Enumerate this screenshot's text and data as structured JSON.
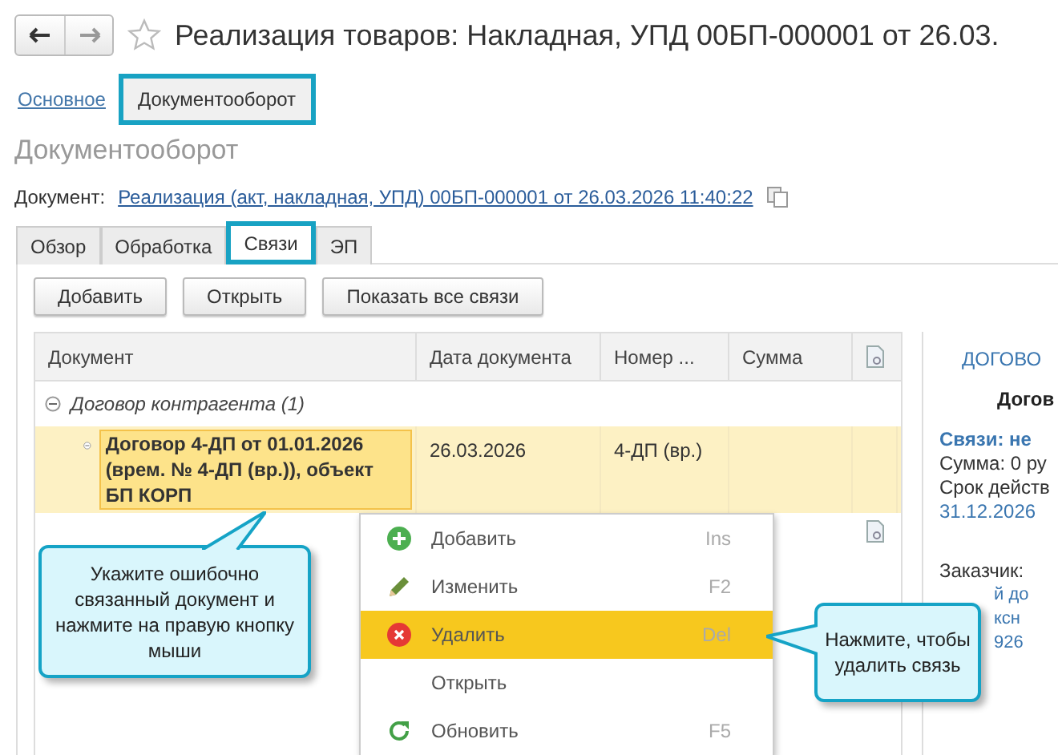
{
  "window": {
    "title": "Реализация товаров: Накладная, УПД 00БП-000001 от 26.03."
  },
  "section_tabs": [
    {
      "label": "Основное",
      "selected": false
    },
    {
      "label": "Документооборот",
      "selected": true
    }
  ],
  "page_heading": "Документооборот",
  "document_field": {
    "label": "Документ:",
    "value": "Реализация (акт, накладная, УПД) 00БП-000001 от 26.03.2026 11:40:22"
  },
  "tabs": [
    {
      "label": "Обзор",
      "selected": false
    },
    {
      "label": "Обработка",
      "selected": false
    },
    {
      "label": "Связи",
      "selected": true
    },
    {
      "label": "ЭП",
      "selected": false
    }
  ],
  "toolbar": [
    "Добавить",
    "Открыть",
    "Показать все связи"
  ],
  "table": {
    "columns": [
      "Документ",
      "Дата документа",
      "Номер ...",
      "Сумма"
    ],
    "rows": [
      {
        "kind": "group",
        "expanded": true,
        "document": "Договор контрагента (1)"
      },
      {
        "kind": "item",
        "expanded": true,
        "selected": true,
        "document": "Договор 4-ДП от 01.01.2026 (врем. № 4-ДП (вр.)), объект БП КОРП",
        "date": "26.03.2026",
        "number": "4-ДП (вр.)"
      },
      {
        "kind": "stub",
        "attachment": true
      }
    ]
  },
  "side_panel": [
    {
      "kind": "caption",
      "text": "ДОГОВО"
    },
    {
      "kind": "title",
      "text": "Догов"
    },
    {
      "kind": "status",
      "text": "Связи: не"
    },
    {
      "kind": "text",
      "text": "Сумма: 0 ру"
    },
    {
      "kind": "text",
      "text": "Срок действ"
    },
    {
      "kind": "link",
      "text": "31.12.2026"
    },
    {
      "kind": "gap"
    },
    {
      "kind": "text",
      "text": "Заказчик:"
    },
    {
      "kind": "link",
      "text": "й до"
    },
    {
      "kind": "link",
      "text": "ксн"
    },
    {
      "kind": "link",
      "text": "926"
    }
  ],
  "context_menu": [
    {
      "kind": "add",
      "label": "Добавить",
      "shortcut": "Ins",
      "selected": false
    },
    {
      "kind": "edit",
      "label": "Изменить",
      "shortcut": "F2",
      "selected": false
    },
    {
      "kind": "delete",
      "label": "Удалить",
      "shortcut": "Del",
      "selected": true
    },
    {
      "kind": "plain",
      "label": "Открыть",
      "selected": false
    },
    {
      "kind": "refresh",
      "label": "Обновить",
      "shortcut": "F5",
      "selected": false
    }
  ],
  "callouts": [
    {
      "kind": "up",
      "text": "Укажите ошибочно связанный документ и нажмите на правую кнопку мыши"
    },
    {
      "kind": "left",
      "text": "Нажмите, чтобы удалить связь"
    }
  ]
}
